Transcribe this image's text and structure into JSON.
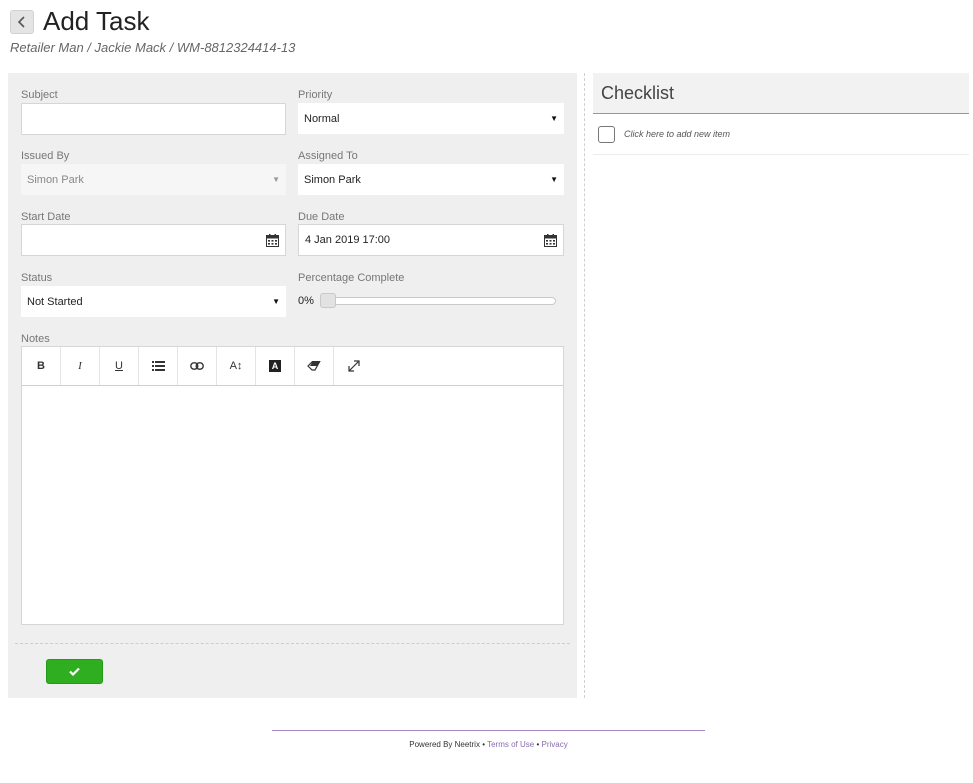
{
  "page": {
    "title": "Add Task",
    "breadcrumb": "Retailer Man / Jackie Mack / WM-8812324414-13"
  },
  "form": {
    "subject": {
      "label": "Subject",
      "value": ""
    },
    "priority": {
      "label": "Priority",
      "value": "Normal"
    },
    "issued_by": {
      "label": "Issued By",
      "value": "Simon Park"
    },
    "assigned_to": {
      "label": "Assigned To",
      "value": "Simon Park"
    },
    "start_date": {
      "label": "Start Date",
      "value": ""
    },
    "due_date": {
      "label": "Due Date",
      "value": "4 Jan 2019 17:00"
    },
    "status": {
      "label": "Status",
      "value": "Not Started"
    },
    "percentage": {
      "label": "Percentage Complete",
      "value_label": "0%",
      "value": 0
    },
    "notes": {
      "label": "Notes",
      "toolbar": [
        {
          "name": "bold-button",
          "glyph": "B",
          "icon": "bold-icon"
        },
        {
          "name": "italic-button",
          "glyph": "I",
          "icon": "italic-icon"
        },
        {
          "name": "underline-button",
          "glyph": "U",
          "icon": "underline-icon"
        },
        {
          "name": "bullet-list-button",
          "glyph": "",
          "icon": "list-icon"
        },
        {
          "name": "link-button",
          "glyph": "",
          "icon": "link-icon"
        },
        {
          "name": "font-size-button",
          "glyph": "A↕",
          "icon": "font-size-icon"
        },
        {
          "name": "text-color-button",
          "glyph": "A",
          "icon": "text-color-icon"
        },
        {
          "name": "clear-format-button",
          "glyph": "",
          "icon": "eraser-icon"
        },
        {
          "name": "fullscreen-button",
          "glyph": "",
          "icon": "expand-icon"
        }
      ],
      "value": ""
    },
    "save": {
      "icon": "checkmark-icon",
      "color": "#2fae1f"
    }
  },
  "checklist": {
    "title": "Checklist",
    "add_item_text": "Click here to add new item"
  },
  "footer": {
    "powered_by": "Powered By Neetrix",
    "separator": "•",
    "terms": "Terms of Use",
    "privacy": "Privacy"
  },
  "colors": {
    "accent": "#a987c6",
    "link": "#8a6ab0",
    "panel_bg": "#efefef"
  }
}
